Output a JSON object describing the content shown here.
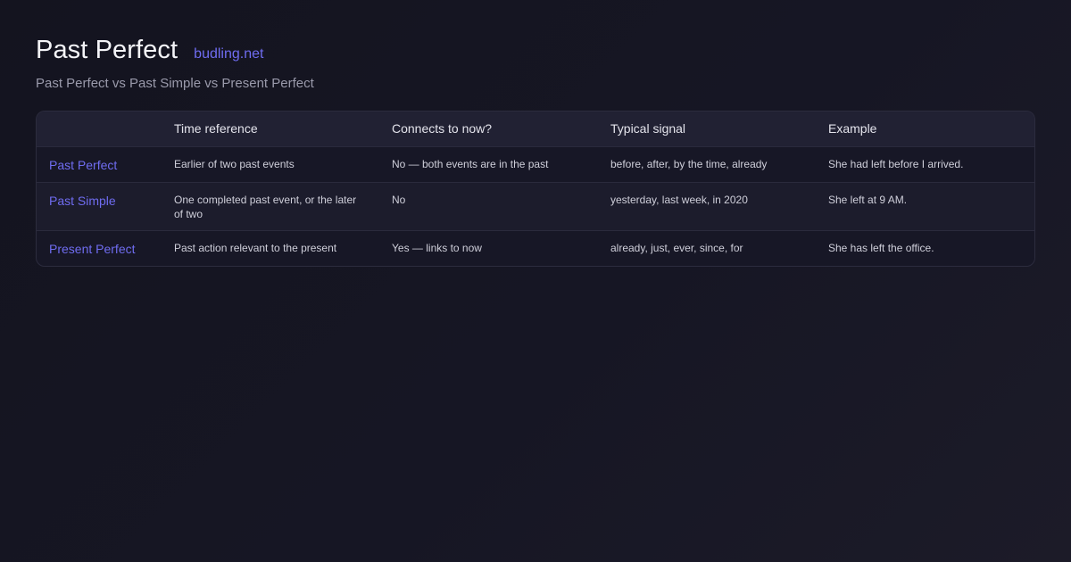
{
  "header": {
    "title": "Past Perfect",
    "site": "budling.net",
    "subtitle": "Past Perfect vs Past Simple vs Present Perfect"
  },
  "table": {
    "columns": [
      "",
      "Time reference",
      "Connects to now?",
      "Typical signal",
      "Example"
    ],
    "rows": [
      {
        "tense": "Past Perfect",
        "time_reference": "Earlier of two past events",
        "connects_to_now": "No — both events are in the past",
        "typical_signal": "before, after, by the time, already",
        "example": "She had left before I arrived."
      },
      {
        "tense": "Past Simple",
        "time_reference": "One completed past event, or the later of two",
        "connects_to_now": "No",
        "typical_signal": "yesterday, last week, in 2020",
        "example": "She left at 9 AM."
      },
      {
        "tense": "Present Perfect",
        "time_reference": "Past action relevant to the present",
        "connects_to_now": "Yes — links to now",
        "typical_signal": "already, just, ever, since, for",
        "example": "She has left the office."
      }
    ]
  },
  "colors": {
    "accent": "#6f6cf0",
    "background": "#14141f",
    "header_row": "#212133"
  }
}
